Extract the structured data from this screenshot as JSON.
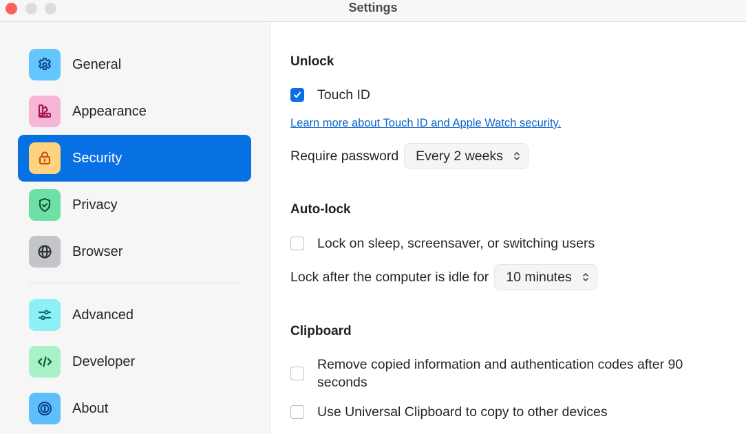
{
  "window": {
    "title": "Settings"
  },
  "sidebar": {
    "items": [
      {
        "id": "general",
        "label": "General",
        "icon": "gear-icon",
        "icon_bg": "#64c6fd",
        "icon_color": "#0b4a8f",
        "active": false
      },
      {
        "id": "appearance",
        "label": "Appearance",
        "icon": "palette-icon",
        "icon_bg": "#f8b6d6",
        "icon_color": "#a3194f",
        "active": false
      },
      {
        "id": "security",
        "label": "Security",
        "icon": "lock-icon",
        "icon_bg": "#fdd37f",
        "icon_color": "#c5540a",
        "active": true
      },
      {
        "id": "privacy",
        "label": "Privacy",
        "icon": "shield-check-icon",
        "icon_bg": "#6ee0a5",
        "icon_color": "#11573a",
        "active": false
      },
      {
        "id": "browser",
        "label": "Browser",
        "icon": "globe-icon",
        "icon_bg": "#c3c5ca",
        "icon_color": "#2d3338",
        "active": false
      },
      {
        "id": "advanced",
        "label": "Advanced",
        "icon": "sliders-icon",
        "icon_bg": "#8cf1f6",
        "icon_color": "#0d6d73",
        "active": false
      },
      {
        "id": "developer",
        "label": "Developer",
        "icon": "code-icon",
        "icon_bg": "#a9f1c6",
        "icon_color": "#17613b",
        "active": false
      },
      {
        "id": "about",
        "label": "About",
        "icon": "info-ring-icon",
        "icon_bg": "#5fbffb",
        "icon_color": "#0b3f8f",
        "active": false
      }
    ],
    "active_color": "#0770e3"
  },
  "main": {
    "unlock": {
      "title": "Unlock",
      "touch_id": {
        "label": "Touch ID",
        "checked": true
      },
      "learn_more_link": "Learn more about Touch ID and Apple Watch security.",
      "require_password": {
        "label": "Require password",
        "value": "Every 2 weeks"
      }
    },
    "autolock": {
      "title": "Auto-lock",
      "lock_on_sleep": {
        "label": "Lock on sleep, screensaver, or switching users",
        "checked": false
      },
      "idle": {
        "label": "Lock after the computer is idle for",
        "value": "10 minutes"
      }
    },
    "clipboard": {
      "title": "Clipboard",
      "remove_copied": {
        "label": "Remove copied information and authentication codes after 90 seconds",
        "checked": false
      },
      "universal": {
        "label": "Use Universal Clipboard to copy to other devices",
        "checked": false
      }
    }
  }
}
